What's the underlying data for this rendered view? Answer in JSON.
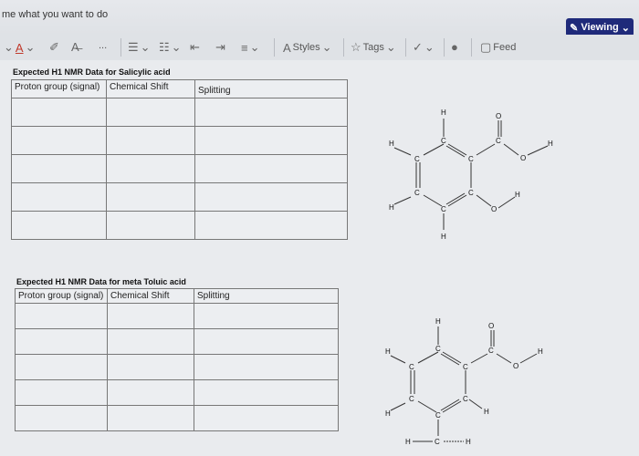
{
  "header": {
    "search_hint": "me what you want to do",
    "viewing_label": "Viewing"
  },
  "toolbar": {
    "more": "...",
    "styles_label": "Styles",
    "tags_label": "Tags",
    "feed_label": "Feed"
  },
  "table1": {
    "caption": "Expected H1 NMR Data for Salicylic acid",
    "headers": [
      "Proton group (signal)",
      "Chemical Shift",
      "Splitting"
    ]
  },
  "table2": {
    "caption": "Expected H1 NMR Data for meta Toluic acid",
    "headers": [
      "Proton group (signal)",
      "Chemical Shift",
      "Splitting"
    ]
  },
  "molecule1": {
    "atoms": {
      "h": "H",
      "c": "C",
      "o": "O"
    }
  },
  "molecule2": {
    "atoms": {
      "h": "H",
      "c": "C",
      "o": "O"
    }
  }
}
